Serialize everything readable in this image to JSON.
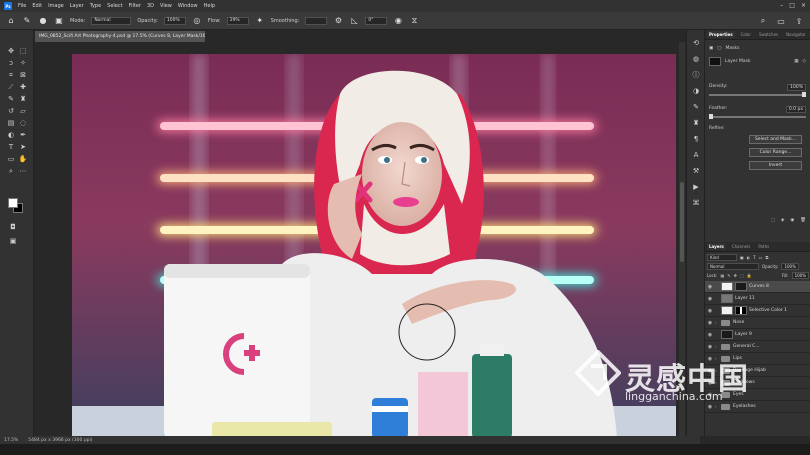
{
  "menubar": {
    "logo": "Ps",
    "items": [
      "File",
      "Edit",
      "Image",
      "Layer",
      "Type",
      "Select",
      "Filter",
      "3D",
      "View",
      "Window",
      "Help"
    ]
  },
  "options": {
    "mode_label": "Mode:",
    "mode_value": "Normal",
    "opacity_label": "Opacity:",
    "opacity_value": "100%",
    "flow_label": "Flow:",
    "flow_value": "29%",
    "smoothing_label": "Smoothing:",
    "angle_value": "0°"
  },
  "document": {
    "tab_title": "IMG_0852_Scifi Art Photography-4.psd @ 17.5% (Curves 8, Layer Mask/16) *"
  },
  "status": {
    "zoom": "17.5%",
    "doc_size": "5484 px x 3966 px (300 ppi)"
  },
  "properties": {
    "tabs": [
      "Properties",
      "Color",
      "Swatches",
      "Navigator"
    ],
    "header": "Masks",
    "mask_label": "Layer Mask",
    "density_label": "Density:",
    "density_value": "100%",
    "feather_label": "Feather:",
    "feather_value": "0.0 px",
    "refine_label": "Refine:",
    "buttons": [
      "Select and Mask...",
      "Color Range...",
      "Invert"
    ]
  },
  "layers": {
    "tabs": [
      "Layers",
      "Channels",
      "Paths"
    ],
    "kind_label": "Kind",
    "blend_mode": "Normal",
    "opacity_label": "Opacity:",
    "opacity_value": "100%",
    "lock_label": "Lock:",
    "fill_label": "Fill:",
    "fill_value": "100%",
    "rows": [
      {
        "name": "Curves 8",
        "type": "adjustment"
      },
      {
        "name": "Layer 11",
        "type": "pixel"
      },
      {
        "name": "Selective Color 1",
        "type": "adjustment"
      },
      {
        "name": "Nose",
        "type": "group"
      },
      {
        "name": "Layer 9",
        "type": "pixel"
      },
      {
        "name": "General C...",
        "type": "group"
      },
      {
        "name": "Lips",
        "type": "group"
      },
      {
        "name": "Bandage Hijab",
        "type": "group"
      },
      {
        "name": "Eyebrows",
        "type": "group"
      },
      {
        "name": "Eyes",
        "type": "group"
      },
      {
        "name": "Eyelashes",
        "type": "group"
      }
    ]
  },
  "watermark": {
    "cn": "灵感中国",
    "en": "lingganchina.com"
  }
}
